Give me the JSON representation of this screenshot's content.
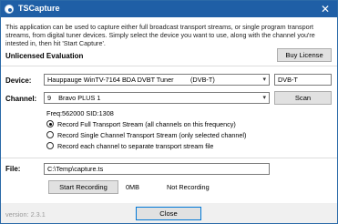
{
  "window": {
    "title": "TSCapture",
    "close_glyph": "✕"
  },
  "description": "This application can be used to capture either full broadcast transport streams, or single program transport streams, from digital tuner devices. Simply select the device you want to use, along with the channel you're intested in, then hit 'Start Capture'.",
  "license": {
    "status_label": "Unlicensed Evaluation",
    "buy_button": "Buy License"
  },
  "device": {
    "label": "Device:",
    "selected": "Hauppauge WinTV-7164 BDA DVBT Tuner",
    "type_in_combo": "(DVB-T)",
    "type_field": "DVB-T"
  },
  "channel": {
    "label": "Channel:",
    "selected": "9    Bravo PLUS 1",
    "scan_button": "Scan",
    "freq_info": "Freq:562000 SID:1308"
  },
  "capture_options": [
    {
      "label": "Record Full Transport Stream (all channels on this frequency)",
      "checked": true
    },
    {
      "label": "Record Single Channel Transport Stream (only selected channel)",
      "checked": false
    },
    {
      "label": "Record each channel to separate transport stream file",
      "checked": false
    }
  ],
  "file": {
    "label": "File:",
    "path": "C:\\Temp\\capture.ts"
  },
  "recording": {
    "start_button": "Start Recording",
    "size": "0MB",
    "status": "Not Recording"
  },
  "footer": {
    "version": "version: 2.3.1",
    "close_button": "Close"
  },
  "icons": {
    "app": "broadcast-icon",
    "combo_arrow": "chevron-down-icon"
  },
  "colors": {
    "titlebar": "#1f5fa6",
    "button": "#e1e1e1"
  }
}
